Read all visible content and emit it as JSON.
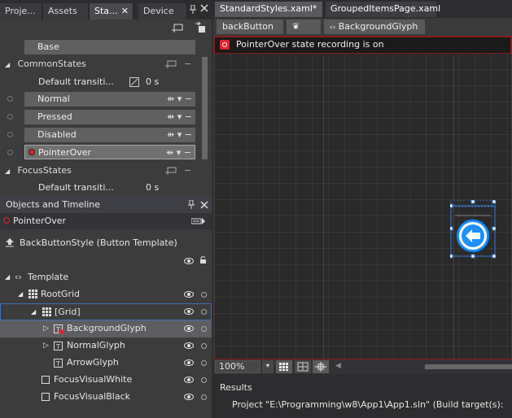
{
  "left_tabs": {
    "items": [
      {
        "label": "Proje..."
      },
      {
        "label": "Assets"
      },
      {
        "label": "Sta..."
      },
      {
        "label": "Device"
      }
    ],
    "close_glyph": "✕",
    "pin_glyph": "📌"
  },
  "states": {
    "base_label": "Base",
    "groups": [
      {
        "name": "CommonStates",
        "default_transition_label": "Default transiti...",
        "default_transition_value": "0 s",
        "states": [
          {
            "label": "Normal"
          },
          {
            "label": "Pressed"
          },
          {
            "label": "Disabled"
          },
          {
            "label": "PointerOver",
            "selected": true,
            "recording": true
          }
        ]
      },
      {
        "name": "FocusStates",
        "default_transition_label": "Default transiti...",
        "default_transition_value": "0 s"
      }
    ],
    "row_controls": "⇻ ▾ −"
  },
  "objects_timeline": {
    "title": "Objects and Timeline",
    "state_selector_value": "PointerOver",
    "template_scope_label": "BackButtonStyle (Button Template)",
    "tree": [
      {
        "label": "Template",
        "depth": 0,
        "expanded": true,
        "icon": "template-icon"
      },
      {
        "label": "RootGrid",
        "depth": 1,
        "expanded": true,
        "icon": "grid-icon"
      },
      {
        "label": "[Grid]",
        "depth": 2,
        "expanded": true,
        "icon": "grid-icon",
        "outlined": true
      },
      {
        "label": "BackgroundGlyph",
        "depth": 3,
        "expandable": true,
        "icon": "textblock-icon",
        "selected": true,
        "recording": true
      },
      {
        "label": "NormalGlyph",
        "depth": 3,
        "expandable": true,
        "icon": "textblock-icon"
      },
      {
        "label": "ArrowGlyph",
        "depth": 3,
        "icon": "textblock-icon"
      },
      {
        "label": "FocusVisualWhite",
        "depth": 2,
        "icon": "rectangle-icon"
      },
      {
        "label": "FocusVisualBlack",
        "depth": 2,
        "icon": "rectangle-icon"
      }
    ]
  },
  "doc_tabs": [
    {
      "label": "StandardStyles.xaml*",
      "active": true
    },
    {
      "label": "GroupedItemsPage.xaml",
      "active": false
    }
  ],
  "breadcrumb": {
    "root": "backButton",
    "leaf": "BackgroundGlyph"
  },
  "recording": {
    "message": "PointerOver state recording is on"
  },
  "artboard": {
    "zoom": "100%"
  },
  "results": {
    "title": "Results",
    "line": "Project \"E:\\Programming\\w8\\App1\\App1.sln\" (Build target(s):"
  },
  "colors": {
    "accent_blue": "#1e90ff",
    "recording_red": "#e0242e",
    "selection_outline": "#3d6fb8"
  }
}
